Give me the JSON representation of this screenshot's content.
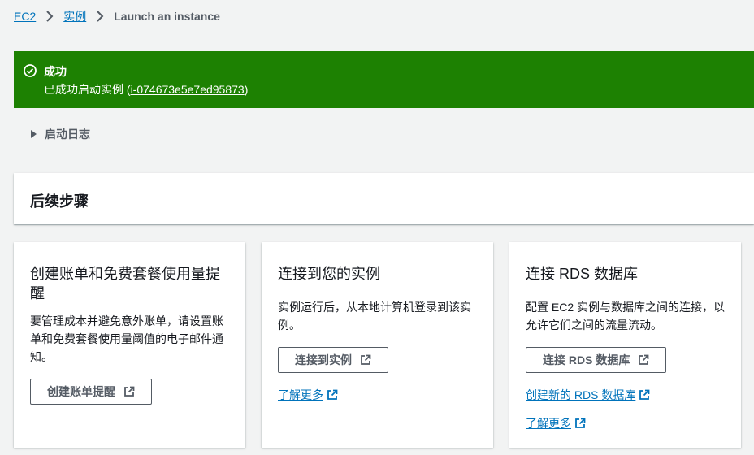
{
  "breadcrumb": {
    "items": [
      "EC2",
      "实例"
    ],
    "current": "Launch an instance"
  },
  "flash": {
    "title": "成功",
    "message_prefix": "已成功启动实例 (",
    "instance_id": "i-074673e5e7ed95873",
    "message_suffix": ")"
  },
  "expander": {
    "label": "启动日志"
  },
  "section": {
    "title": "后续步骤"
  },
  "cards": [
    {
      "title": "创建账单和免费套餐使用量提醒",
      "description": "要管理成本并避免意外账单，请设置账单和免费套餐使用量阈值的电子邮件通知。",
      "button": "创建账单提醒"
    },
    {
      "title": "连接到您的实例",
      "description": "实例运行后，从本地计算机登录到该实例。",
      "button": "连接到实例",
      "link1": "了解更多"
    },
    {
      "title": "连接 RDS 数据库",
      "description": "配置 EC2 实例与数据库之间的连接，以允许它们之间的流量流动。",
      "button": "连接 RDS 数据库",
      "link1": "创建新的 RDS 数据库",
      "link2": "了解更多"
    }
  ],
  "colors": {
    "success": "#1d8102",
    "link": "#0073bb",
    "text": "#16191f",
    "muted": "#545b64"
  }
}
